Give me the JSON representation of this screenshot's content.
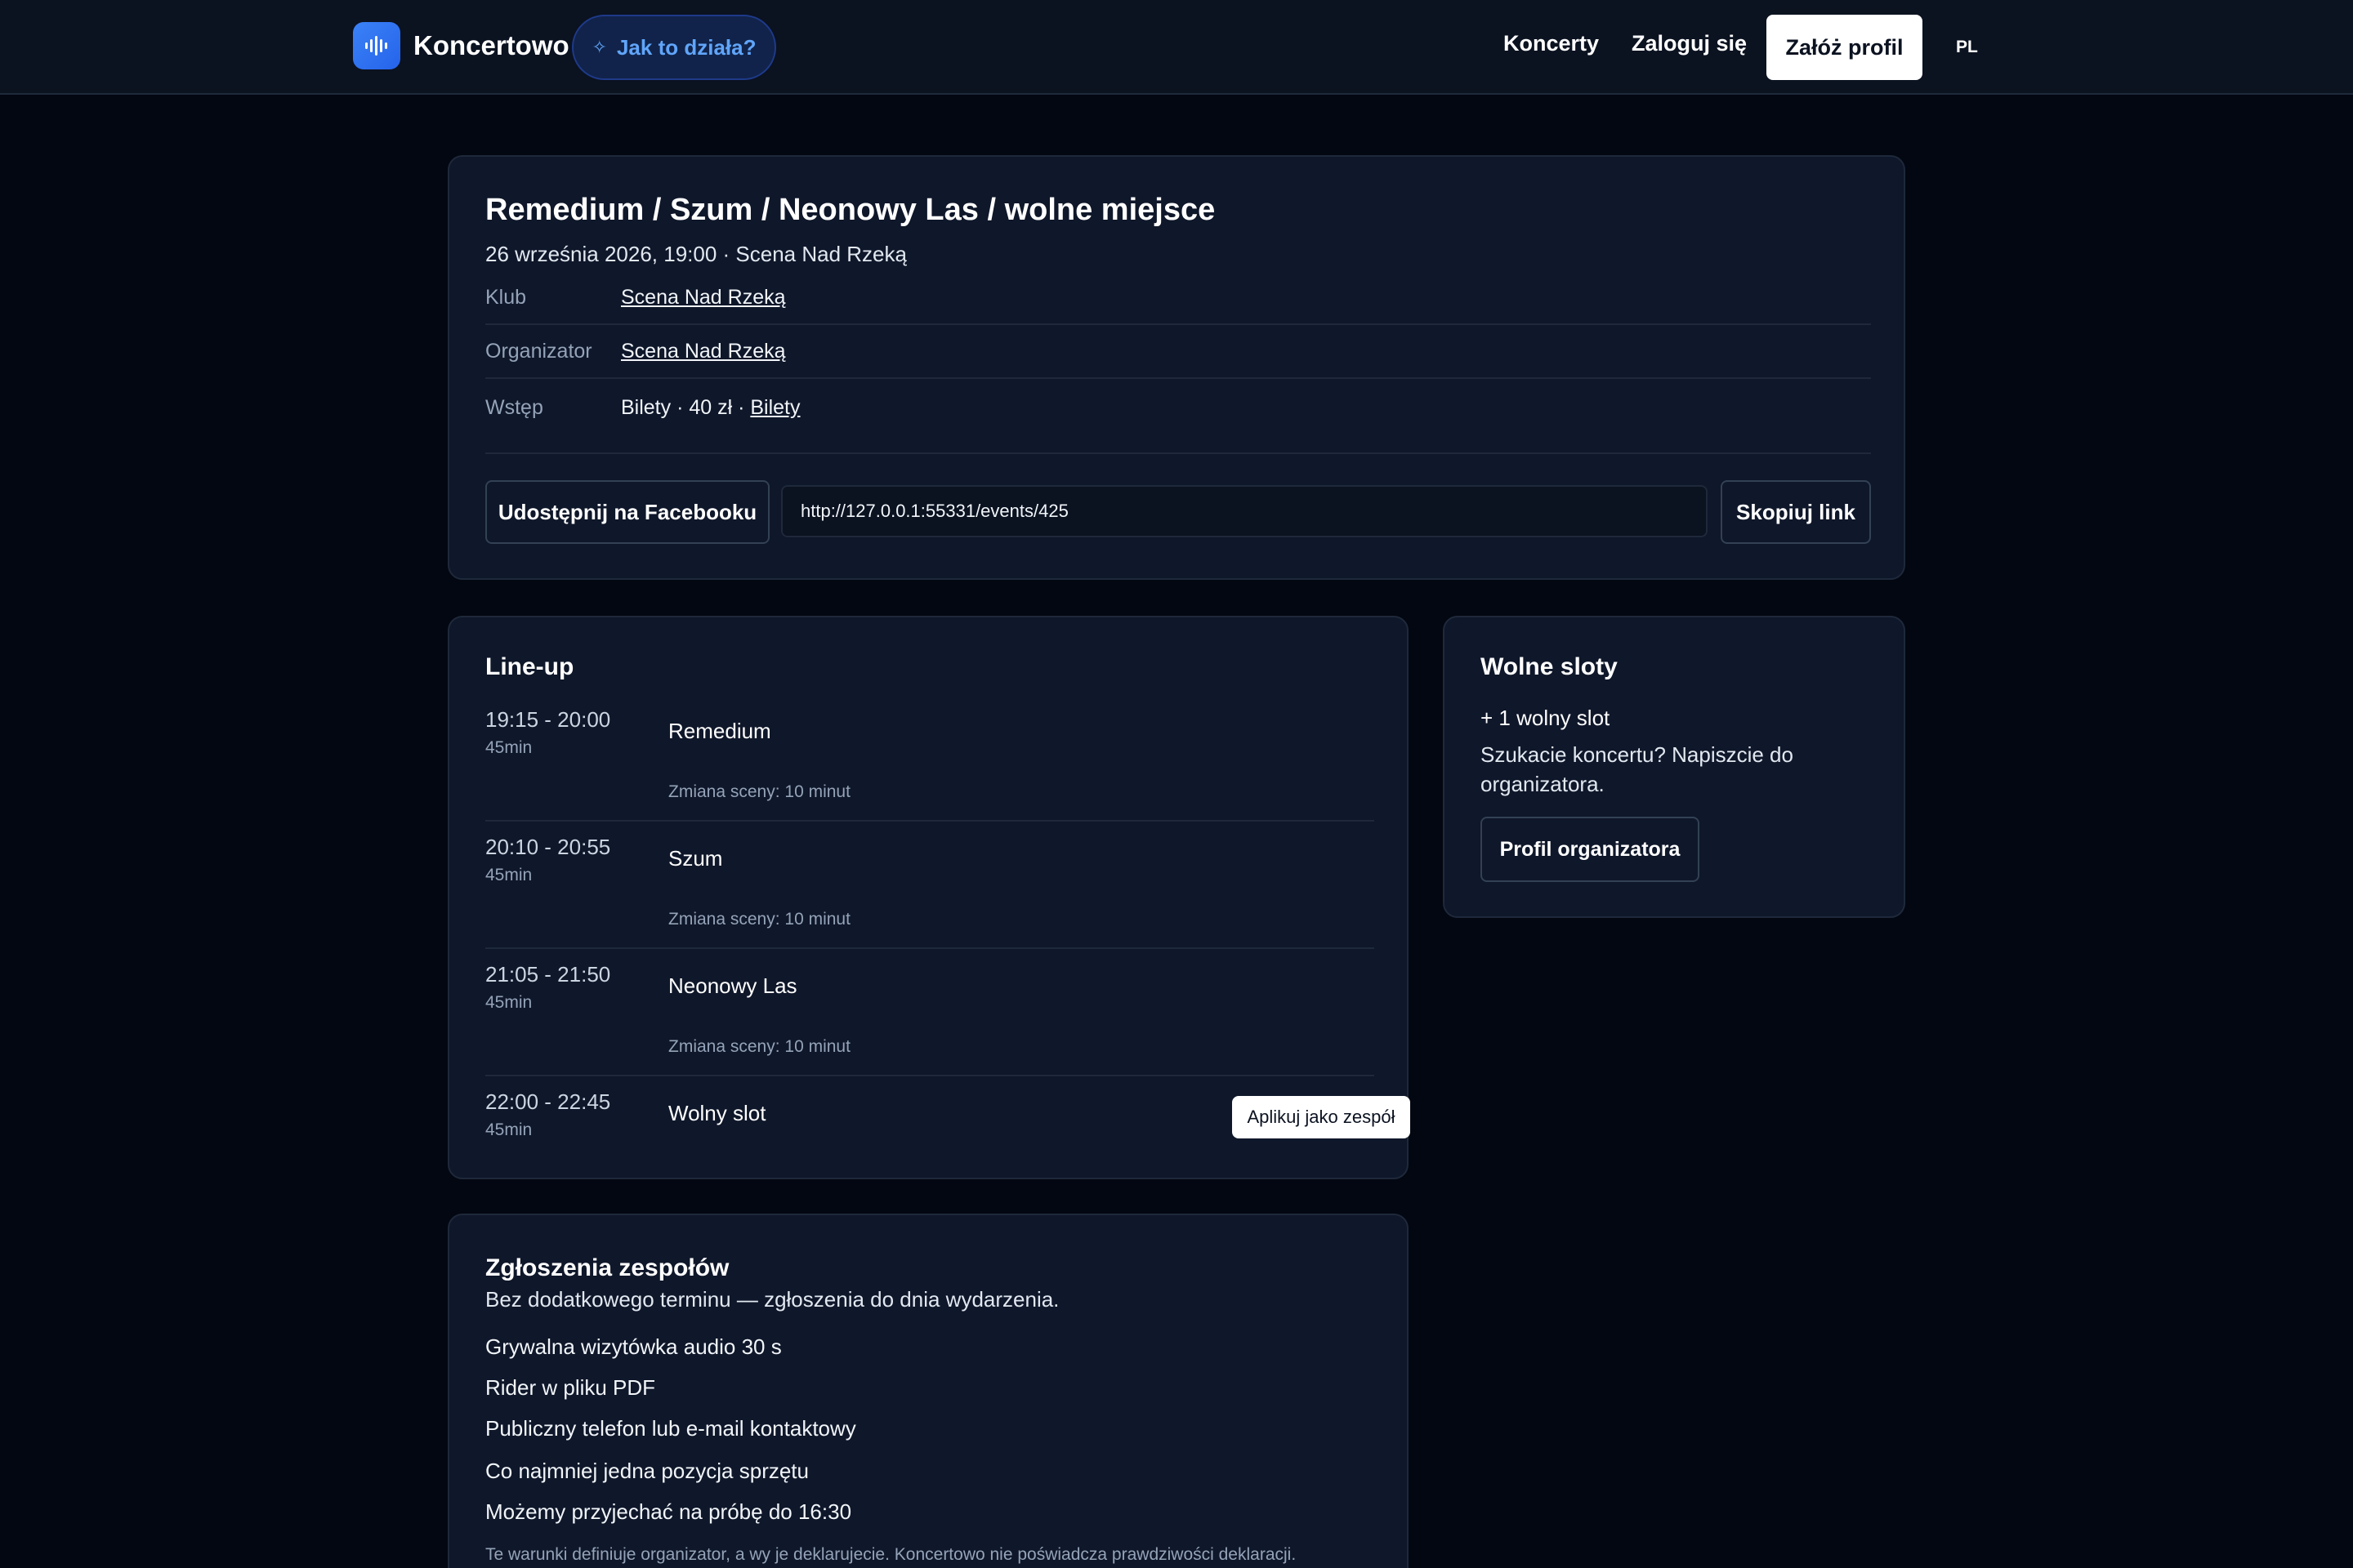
{
  "header": {
    "brand": "Koncertowo",
    "how_it_works": "Jak to działa?",
    "nav": {
      "concerts": "Koncerty",
      "login": "Zaloguj się",
      "create_profile": "Załóż profil",
      "lang": "PL"
    }
  },
  "event": {
    "title": "Remedium / Szum / Neonowy Las / wolne miejsce",
    "subtitle": "26 września 2026, 19:00 · Scena Nad Rzeką",
    "rows": {
      "club": {
        "label": "Klub",
        "value": "Scena Nad Rzeką"
      },
      "organizer": {
        "label": "Organizator",
        "value": "Scena Nad Rzeką"
      },
      "entry": {
        "label": "Wstęp",
        "value": "Bilety · 40 zł · ",
        "link": "Bilety"
      }
    },
    "share_facebook": "Udostępnij na Facebooku",
    "share_url": "http://127.0.0.1:55331/events/425",
    "copy_link": "Skopiuj link"
  },
  "lineup": {
    "title": "Line-up",
    "slots": [
      {
        "time": "19:15 - 20:00",
        "duration": "45min",
        "band": "Remedium",
        "change": "Zmiana sceny: 10 minut"
      },
      {
        "time": "20:10 - 20:55",
        "duration": "45min",
        "band": "Szum",
        "change": "Zmiana sceny: 10 minut"
      },
      {
        "time": "21:05 - 21:50",
        "duration": "45min",
        "band": "Neonowy Las",
        "change": "Zmiana sceny: 10 minut"
      },
      {
        "time": "22:00 - 22:45",
        "duration": "45min",
        "band": "Wolny slot",
        "apply": "Aplikuj jako zespół"
      }
    ]
  },
  "free_slots": {
    "title": "Wolne sloty",
    "count": "+ 1 wolny slot",
    "text": "Szukacie koncertu? Napiszcie do organizatora.",
    "button": "Profil organizatora"
  },
  "applications": {
    "title": "Zgłoszenia zespołów",
    "subtitle": "Bez dodatkowego terminu — zgłoszenia do dnia wydarzenia.",
    "requirements": [
      "Grywalna wizytówka audio 30 s",
      "Rider w pliku PDF",
      "Publiczny telefon lub e-mail kontaktowy",
      "Co najmniej jedna pozycja sprzętu",
      "Możemy przyjechać na próbę do 16:30"
    ],
    "note": "Te warunki definiuje organizator, a wy je deklarujecie. Koncertowo nie poświadcza prawdziwości deklaracji."
  }
}
